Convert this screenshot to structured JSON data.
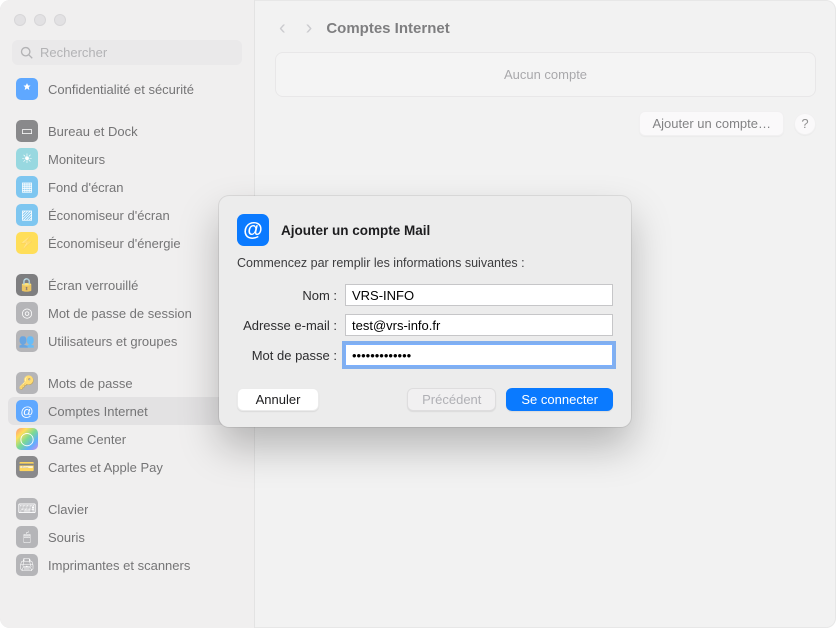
{
  "search": {
    "placeholder": "Rechercher"
  },
  "sidebar": {
    "items": [
      {
        "label": "Confidentialité et sécurité"
      },
      {
        "label": "Bureau et Dock"
      },
      {
        "label": "Moniteurs"
      },
      {
        "label": "Fond d'écran"
      },
      {
        "label": "Économiseur d'écran"
      },
      {
        "label": "Économiseur d'énergie"
      },
      {
        "label": "Écran verrouillé"
      },
      {
        "label": "Mot de passe de session"
      },
      {
        "label": "Utilisateurs et groupes"
      },
      {
        "label": "Mots de passe"
      },
      {
        "label": "Comptes Internet"
      },
      {
        "label": "Game Center"
      },
      {
        "label": "Cartes et Apple Pay"
      },
      {
        "label": "Clavier"
      },
      {
        "label": "Souris"
      },
      {
        "label": "Imprimantes et scanners"
      }
    ]
  },
  "header": {
    "title": "Comptes Internet",
    "empty_state": "Aucun compte",
    "add_account": "Ajouter un compte…",
    "help": "?"
  },
  "dialog": {
    "title": "Ajouter un compte Mail",
    "subtitle": "Commencez par remplir les informations suivantes :",
    "fields": {
      "name_label": "Nom :",
      "name_value": "VRS-INFO",
      "email_label": "Adresse e-mail :",
      "email_value": "test@vrs-info.fr",
      "password_label": "Mot de passe :",
      "password_value": "•••••••••••••"
    },
    "buttons": {
      "cancel": "Annuler",
      "previous": "Précédent",
      "connect": "Se connecter"
    }
  }
}
